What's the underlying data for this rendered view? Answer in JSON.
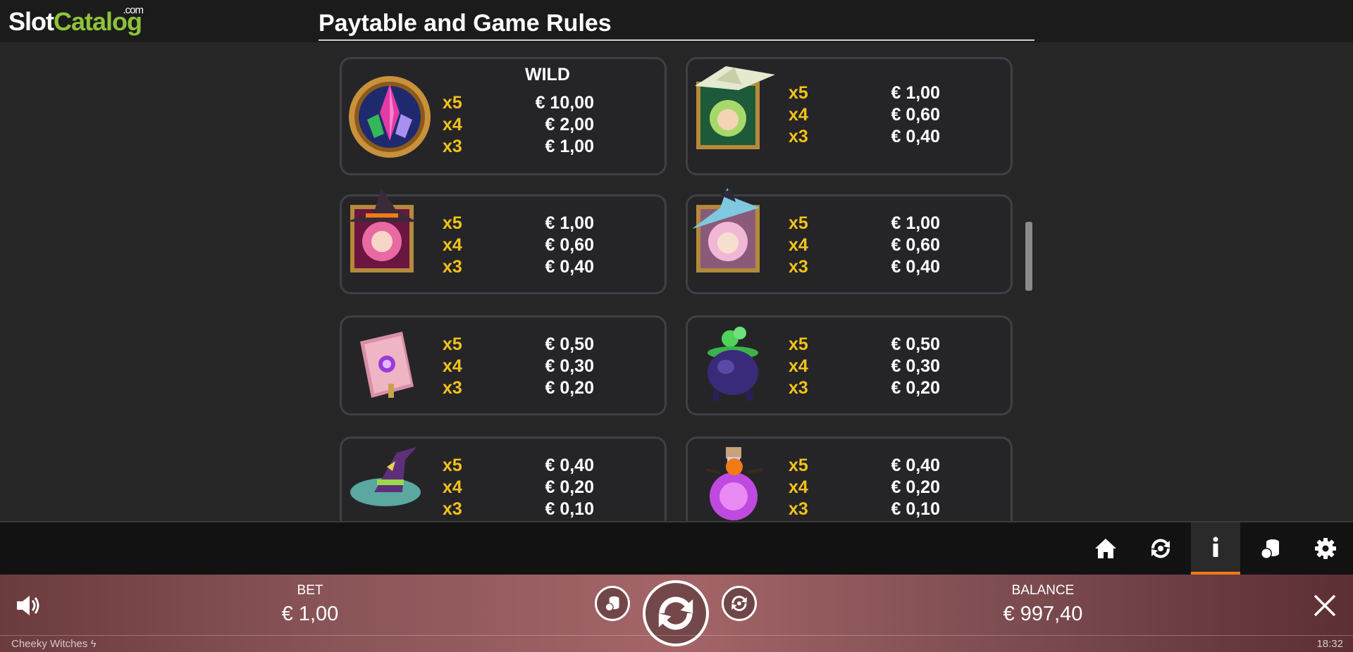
{
  "logo": {
    "text_slot": "Slot",
    "text_catalog": "Catalog",
    "text_com": ".com"
  },
  "page": {
    "title": "Paytable and Game Rules"
  },
  "paytable": [
    {
      "symbol": "crystal-wild",
      "label": "WILD",
      "pays": [
        {
          "mult": "x5",
          "amount": "€ 10,00"
        },
        {
          "mult": "x4",
          "amount": "€ 2,00"
        },
        {
          "mult": "x3",
          "amount": "€ 1,00"
        }
      ]
    },
    {
      "symbol": "green-witch",
      "pays": [
        {
          "mult": "x5",
          "amount": "€ 1,00"
        },
        {
          "mult": "x4",
          "amount": "€ 0,60"
        },
        {
          "mult": "x3",
          "amount": "€ 0,40"
        }
      ]
    },
    {
      "symbol": "pink-witch",
      "pays": [
        {
          "mult": "x5",
          "amount": "€ 1,00"
        },
        {
          "mult": "x4",
          "amount": "€ 0,60"
        },
        {
          "mult": "x3",
          "amount": "€ 0,40"
        }
      ]
    },
    {
      "symbol": "blue-witch",
      "pays": [
        {
          "mult": "x5",
          "amount": "€ 1,00"
        },
        {
          "mult": "x4",
          "amount": "€ 0,60"
        },
        {
          "mult": "x3",
          "amount": "€ 0,40"
        }
      ]
    },
    {
      "symbol": "spell-book",
      "pays": [
        {
          "mult": "x5",
          "amount": "€ 0,50"
        },
        {
          "mult": "x4",
          "amount": "€ 0,30"
        },
        {
          "mult": "x3",
          "amount": "€ 0,20"
        }
      ]
    },
    {
      "symbol": "cauldron",
      "pays": [
        {
          "mult": "x5",
          "amount": "€ 0,50"
        },
        {
          "mult": "x4",
          "amount": "€ 0,30"
        },
        {
          "mult": "x3",
          "amount": "€ 0,20"
        }
      ]
    },
    {
      "symbol": "witch-hat",
      "pays": [
        {
          "mult": "x5",
          "amount": "€ 0,40"
        },
        {
          "mult": "x4",
          "amount": "€ 0,20"
        },
        {
          "mult": "x3",
          "amount": "€ 0,10"
        }
      ]
    },
    {
      "symbol": "potion-bottle",
      "pays": [
        {
          "mult": "x5",
          "amount": "€ 0,40"
        },
        {
          "mult": "x4",
          "amount": "€ 0,20"
        },
        {
          "mult": "x3",
          "amount": "€ 0,10"
        }
      ]
    }
  ],
  "toolbar": {
    "items": [
      {
        "icon": "home-icon"
      },
      {
        "icon": "autoplay-icon"
      },
      {
        "icon": "info-icon",
        "active": true
      },
      {
        "icon": "coins-icon"
      },
      {
        "icon": "gear-icon"
      }
    ],
    "accent_color": "#f27a17"
  },
  "bottom": {
    "bet_label": "BET",
    "bet_value": "€ 1,00",
    "balance_label": "BALANCE",
    "balance_value": "€ 997,40",
    "game_name": "Cheeky Witches",
    "clock": "18:32"
  },
  "colors": {
    "multiplier": "#f2c21a",
    "card_border": "#3f3f47",
    "background": "#262626"
  }
}
